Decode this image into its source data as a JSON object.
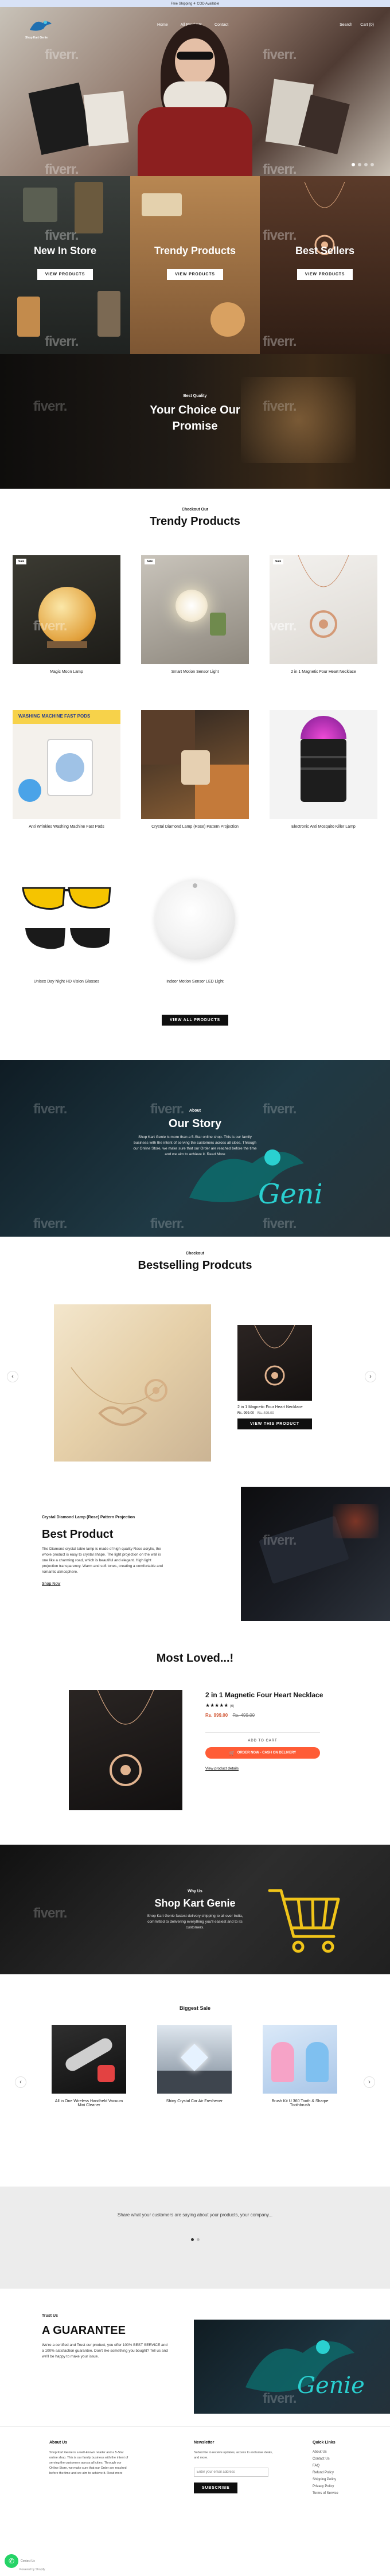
{
  "announcement": {
    "text": "Free Shipping ✈ COD Available"
  },
  "header": {
    "logo_text": "Shop Kart Genie",
    "nav": [
      "Home",
      "All Products",
      "Contact"
    ],
    "actions": {
      "search": "Search",
      "cart": "Cart (0)"
    }
  },
  "hero": {
    "dots": 4
  },
  "watermark": "fiverr.",
  "categories": [
    {
      "title": "New In Store",
      "button": "VIEW PRODUCTS"
    },
    {
      "title": "Trendy Products",
      "button": "VIEW PRODUCTS"
    },
    {
      "title": "Best Sellers",
      "button": "VIEW PRODUCTS"
    }
  ],
  "promise": {
    "kicker": "Best Quality",
    "title_line1": "Your Choice Our",
    "title_line2": "Promise"
  },
  "trendy": {
    "kicker": "Checkout Our",
    "title": "Trendy Products",
    "products": [
      {
        "name": "Magic Moon Lamp",
        "badge": "Sale"
      },
      {
        "name": "Smart Motion Sensor Light",
        "badge": "Sale"
      },
      {
        "name": "2 in 1 Magnetic Four Heart Necklace",
        "badge": "Sale"
      },
      {
        "name": "Anti Wrinkles Washing Machine Fast Pods",
        "badge": ""
      },
      {
        "name": "Crystal Diamond Lamp (Rose) Pattern Projection",
        "badge": ""
      },
      {
        "name": "Electronic Anti Mosquito Killer Lamp",
        "badge": ""
      },
      {
        "name": "Unisex Day Night HD Vision Glasses",
        "badge": ""
      },
      {
        "name": "Indoor Motion Sensor LED Light",
        "badge": ""
      }
    ],
    "view_all": "VIEW ALL PRODUCTS"
  },
  "story": {
    "kicker": "About",
    "title": "Our Story",
    "body": "Shop Kart Genie is more than a 5-Star online shop. This is our family business with the intent of serving the customers across all cities. Through our Online Store, we make sure that our Order are reached before the time and we aim to achieve it. Read More"
  },
  "bestselling": {
    "kicker": "Checkout",
    "title": "Bestselling Prodcuts",
    "item": {
      "name": "2 in 1 Magnetic Four Heart Necklace",
      "price": "Rs. 999.00",
      "compare": "Rs. 499.00",
      "button": "VIEW THIS PRODUCT"
    }
  },
  "best_product": {
    "kicker": "Crystal Diamond Lamp (Rose) Pattern Projection",
    "title": "Best Product",
    "body": "The Diamond crystal table lamp is made of high quality Rose acrylic, the whole product is easy to crystal shape. The light projection on the wall is one like a charming road, which is beautiful and elegant. High light projection transparency. Warm and soft tones, creating a comfortable and romantic atmosphere.",
    "link": "Shop Now"
  },
  "most_loved": {
    "title": "Most Loved...!",
    "product": "2 in 1 Magnetic Four Heart Necklace",
    "stars": "★★★★★",
    "reviews": "(6)",
    "price": "Rs. 999.00",
    "compare": "Rs. 499.00",
    "add_to_cart": "ADD TO CART",
    "order_now": "ORDER NOW - CASH ON DELIVERY",
    "details": "View product details"
  },
  "why": {
    "kicker": "Why Us",
    "title": "Shop Kart Genie",
    "body": "Shop Kart Genie fastest delivery shipping to all over India, committed to delivering everything you'll easiest and to its customers."
  },
  "biggest_sale": {
    "title": "Biggest Sale",
    "items": [
      "All in One Wireless Handheld Vacuum Mini Cleaner",
      "Shiny Crystal Car Air Freshener",
      "Brush Kit U 360 Tooth & Sharpe Toothbrush"
    ]
  },
  "testimonial": {
    "text": "Share what your customers are saying about your products, your company..."
  },
  "guarantee": {
    "kicker": "Trust Us",
    "title": "A GUARANTEE",
    "body": "We're a certified and Trust our product, you offer 100% BEST SERVICE and a 100% satisfaction guarantee. Don't like something you bought? Tell us and we'll be happy to make your issue."
  },
  "footer": {
    "about_title": "About Us",
    "about_body": "Shop Kart Genie is a well-known retailer and a 5-Star online shop. This is our family business with the intent of serving the customers across all cities. Through our Online Store, we make sure that our Order are reached before the time and we aim to achieve it. Read more",
    "newsletter_title": "Newsletter",
    "newsletter_body": "Subscribe to receive updates, access to exclusive deals, and more.",
    "email_placeholder": "Enter your email address",
    "subscribe": "SUBSCRIBE",
    "links_title": "Quick Links",
    "links": [
      "About Us",
      "Contact Us",
      "FAQ",
      "Refund Policy",
      "Shipping Policy",
      "Privacy Policy",
      "Terms of Service"
    ],
    "whatsapp": "Contact Us",
    "powered": "Powered by Shopify"
  },
  "colors": {
    "accent_blue": "#0f7fc7",
    "order_orange": "#ff5c36",
    "teal": "#2ad0d0",
    "dark": "#171717"
  }
}
